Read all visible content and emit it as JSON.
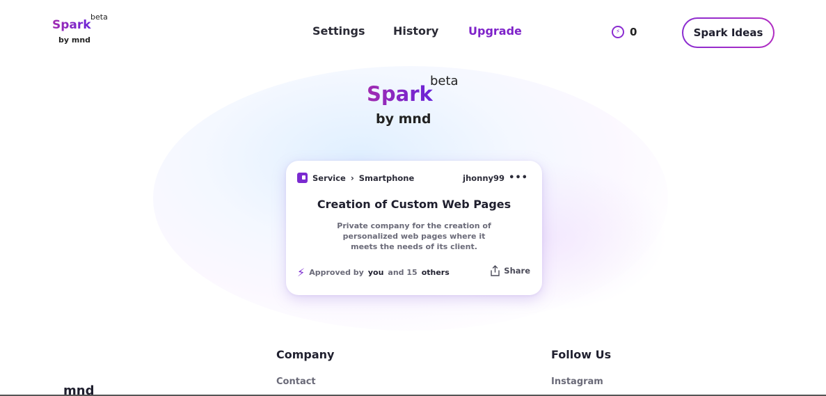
{
  "header": {
    "logo": {
      "name": "Spark",
      "beta": "beta",
      "byline": "by mnd"
    },
    "nav": [
      {
        "label": "Settings"
      },
      {
        "label": "History"
      },
      {
        "label": "Upgrade"
      }
    ],
    "credits": {
      "value": "0",
      "icon": "lightning-coin-icon"
    },
    "cta_label": "Spark Ideas",
    "colors": {
      "accent": "#7e22c9",
      "gradient_start": "#a12bb0",
      "gradient_end": "#6a24d8"
    }
  },
  "hero": {
    "logo": {
      "name": "Spark",
      "beta": "beta",
      "byline": "by mnd"
    }
  },
  "card": {
    "category": "Service",
    "subcategory": "Smartphone",
    "category_icon": "service-icon",
    "username": "jhonny99",
    "more_icon": "more-dots-icon",
    "title": "Creation of Custom Web Pages",
    "description": "Private company for the creation of personalized web pages where it meets the needs of its client.",
    "approved_prefix": "Approved by",
    "approved_you": "you",
    "approved_middle": "and 15",
    "approved_others": "others",
    "share_label": "Share"
  },
  "footer": {
    "logo": "mnd",
    "company_title": "Company",
    "company_links": [
      "Contact"
    ],
    "follow_title": "Follow Us",
    "follow_links": [
      "Instagram"
    ]
  }
}
